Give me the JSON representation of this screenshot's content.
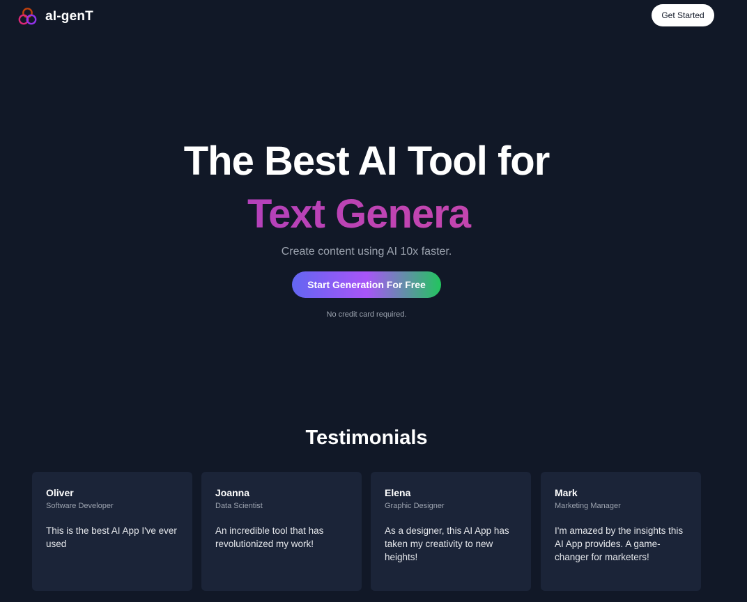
{
  "nav": {
    "logo_text": "aI-genT",
    "get_started_label": "Get Started"
  },
  "hero": {
    "title": "The Best AI Tool for",
    "typed_text": "Text Genera",
    "subtitle": "Create content using AI 10x faster.",
    "cta_label": "Start Generation For Free",
    "note": "No credit card required."
  },
  "testimonials": {
    "heading": "Testimonials",
    "items": [
      {
        "name": "Oliver",
        "role": "Software Developer",
        "quote": "This is the best AI App I've ever used"
      },
      {
        "name": "Joanna",
        "role": "Data Scientist",
        "quote": "An incredible tool that has revolutionized my work!"
      },
      {
        "name": "Elena",
        "role": "Graphic Designer",
        "quote": "As a designer, this AI App has taken my creativity to new heights!"
      },
      {
        "name": "Mark",
        "role": "Marketing Manager",
        "quote": "I'm amazed by the insights this AI App provides. A game-changer for marketers!"
      }
    ]
  },
  "colors": {
    "background": "#111827",
    "card": "#1b2438",
    "accent_gradient": [
      "#6366f1",
      "#a855f7",
      "#22c55e"
    ],
    "typed_text": "#c245b0"
  },
  "icons": {
    "logo": "interlocking-rings-icon"
  }
}
